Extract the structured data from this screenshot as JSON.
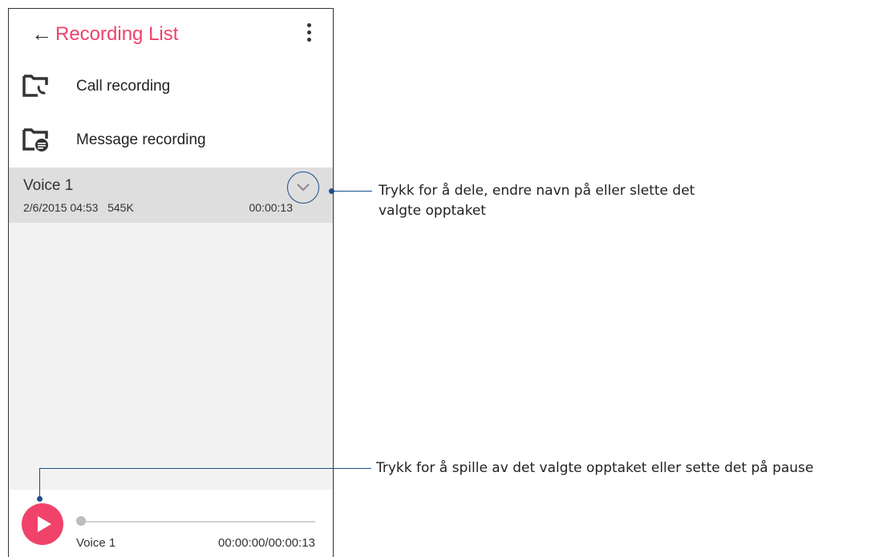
{
  "app_bar": {
    "title": "Recording List",
    "back_icon": "arrow-left-icon",
    "menu_icon": "more-vert-icon"
  },
  "folders": [
    {
      "label": "Call recording",
      "icon": "call-folder-icon"
    },
    {
      "label": "Message recording",
      "icon": "message-folder-icon"
    }
  ],
  "selected_recording": {
    "name": "Voice 1",
    "date": "2/6/2015 04:53",
    "size": "545K",
    "duration": "00:00:13",
    "expand_icon": "chevron-down-icon"
  },
  "player": {
    "name": "Voice 1",
    "time": "00:00:00/00:00:13",
    "progress": 0,
    "play_icon": "play-icon"
  },
  "callouts": {
    "expand_line1": "Trykk for å dele, endre navn på eller slette det",
    "expand_line2": "valgte opptaket",
    "play": "Trykk for å spille av det valgte opptaket eller sette det på pause"
  },
  "colors": {
    "accent": "#f0426b",
    "callout": "#1a4f8b",
    "list_bg": "#f2f2f2",
    "selected_bg": "#dedede"
  }
}
